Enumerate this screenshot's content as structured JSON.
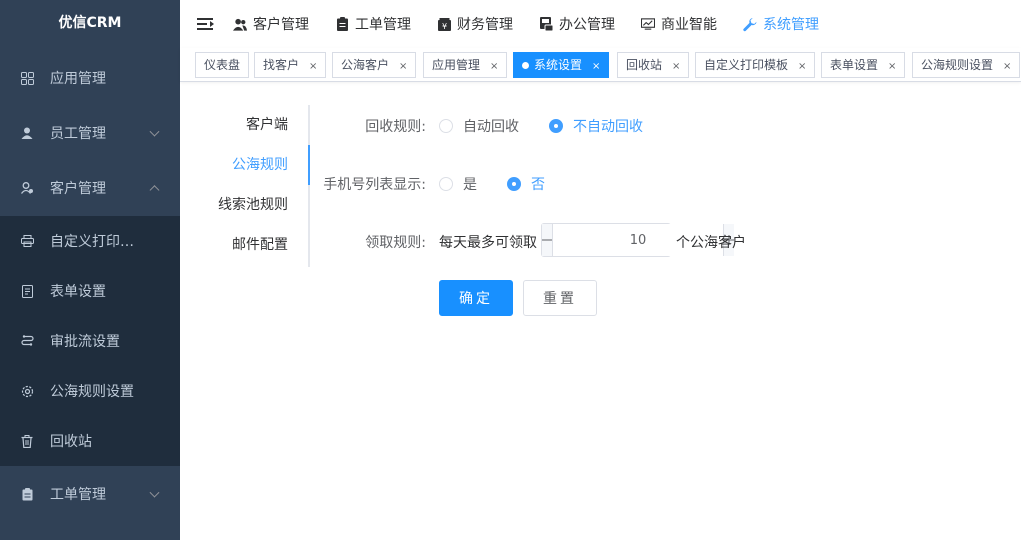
{
  "app": {
    "title": "优信CRM"
  },
  "sidebar": {
    "items": [
      {
        "label": "应用管理",
        "icon": "grid-icon"
      },
      {
        "label": "员工管理",
        "icon": "user-icon"
      },
      {
        "label": "客户管理",
        "icon": "customer-icon"
      }
    ],
    "submenu": [
      {
        "label": "自定义打印模板",
        "icon": "printer-icon"
      },
      {
        "label": "表单设置",
        "icon": "form-icon"
      },
      {
        "label": "审批流设置",
        "icon": "flow-icon"
      },
      {
        "label": "公海规则设置",
        "icon": "settings-icon"
      },
      {
        "label": "回收站",
        "icon": "trash-icon"
      }
    ],
    "bottom": {
      "label": "工单管理",
      "icon": "clipboard-icon"
    }
  },
  "topnav": {
    "items": [
      {
        "label": "客户管理",
        "icon": "users-icon"
      },
      {
        "label": "工单管理",
        "icon": "clipboard-icon"
      },
      {
        "label": "财务管理",
        "icon": "finance-icon"
      },
      {
        "label": "办公管理",
        "icon": "office-icon"
      },
      {
        "label": "商业智能",
        "icon": "chart-icon"
      },
      {
        "label": "系统管理",
        "icon": "wrench-icon",
        "active": true
      }
    ]
  },
  "tags": [
    {
      "label": "仪表盘"
    },
    {
      "label": "找客户"
    },
    {
      "label": "公海客户"
    },
    {
      "label": "应用管理"
    },
    {
      "label": "系统设置",
      "active": true
    },
    {
      "label": "回收站"
    },
    {
      "label": "自定义打印模板"
    },
    {
      "label": "表单设置"
    },
    {
      "label": "公海规则设置"
    }
  ],
  "tabs": [
    {
      "label": "客户端"
    },
    {
      "label": "公海规则",
      "active": true
    },
    {
      "label": "线索池规则"
    },
    {
      "label": "邮件配置"
    }
  ],
  "form": {
    "recycle": {
      "label": "回收规则:",
      "options": [
        "自动回收",
        "不自动回收"
      ],
      "selected": "不自动回收"
    },
    "phone": {
      "label": "手机号列表显示:",
      "options": [
        "是",
        "否"
      ],
      "selected": "否"
    },
    "claim": {
      "label": "领取规则:",
      "prefix": "每天最多可领取",
      "value": "10",
      "suffix": "个公海客户"
    },
    "confirm_label": "确定",
    "reset_label": "重置"
  },
  "colors": {
    "primary": "#1890ff",
    "sidebar_bg": "#304156",
    "submenu_bg": "#1f2d3d"
  }
}
